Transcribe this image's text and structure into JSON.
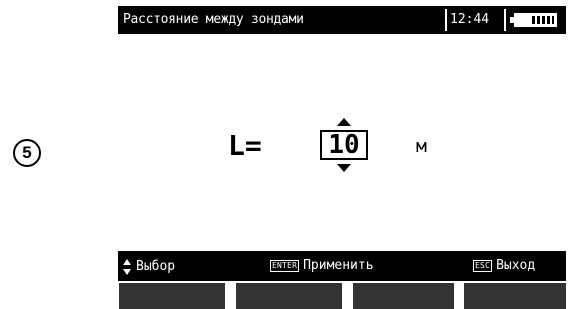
{
  "step_marker": "5",
  "header": {
    "title": "Расстояние между зондами",
    "time": "12:44",
    "battery_icon": "battery-icon",
    "battery_level": 0.6
  },
  "main": {
    "variable_label": "L=",
    "value": "10",
    "unit": "м"
  },
  "softkeys": {
    "select_label": "Выбор",
    "apply_key": "ENTER",
    "apply_label": "Применить",
    "exit_key": "ESC",
    "exit_label": "Выход"
  },
  "function_keys": [
    "",
    "",
    "",
    ""
  ],
  "colors": {
    "screen_background": "#ffffff",
    "bar_background": "#000000",
    "function_key": "#333333"
  }
}
